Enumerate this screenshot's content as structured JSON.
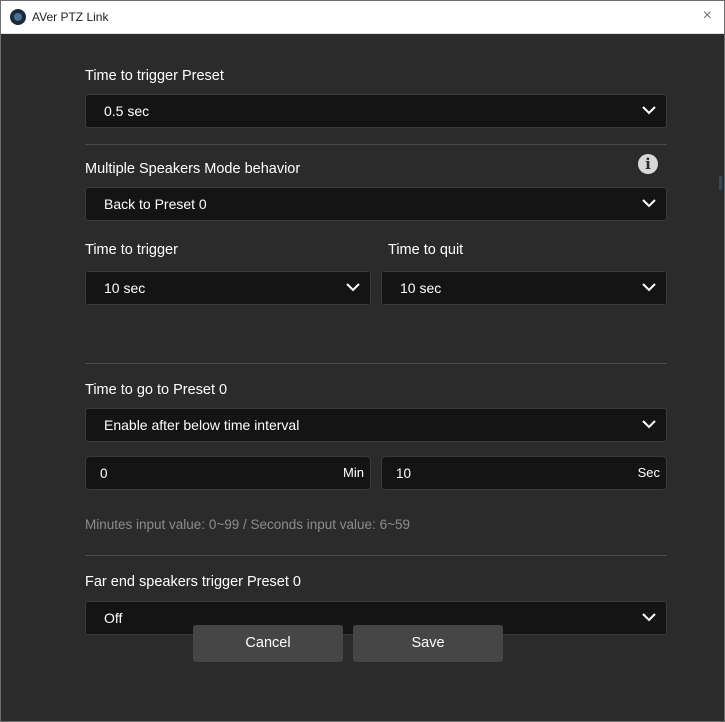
{
  "window": {
    "title": "AVer PTZ Link",
    "close_glyph": "×"
  },
  "preset_trigger": {
    "label": "Time to trigger Preset",
    "value": "0.5 sec"
  },
  "multi_speakers": {
    "label": "Multiple Speakers Mode behavior",
    "info_glyph": "i",
    "value": "Back to Preset 0",
    "trigger_label": "Time to trigger",
    "trigger_value": "10 sec",
    "quit_label": "Time to quit",
    "quit_value": "10 sec"
  },
  "go_preset0": {
    "label": "Time to go to Preset 0",
    "value": "Enable after below time interval",
    "minutes_value": "0",
    "minutes_unit": "Min",
    "seconds_value": "10",
    "seconds_unit": "Sec",
    "hint": "Minutes input value: 0~99 / Seconds input value: 6~59"
  },
  "far_end": {
    "label": "Far end speakers trigger Preset 0",
    "value": "Off"
  },
  "buttons": {
    "cancel": "Cancel",
    "save": "Save"
  },
  "icons": [
    "app-logo-icon",
    "close-icon",
    "info-icon",
    "chevron-down-icon"
  ],
  "colors": {
    "background": "#2b2b2b",
    "field": "#141414",
    "button": "#464646"
  }
}
